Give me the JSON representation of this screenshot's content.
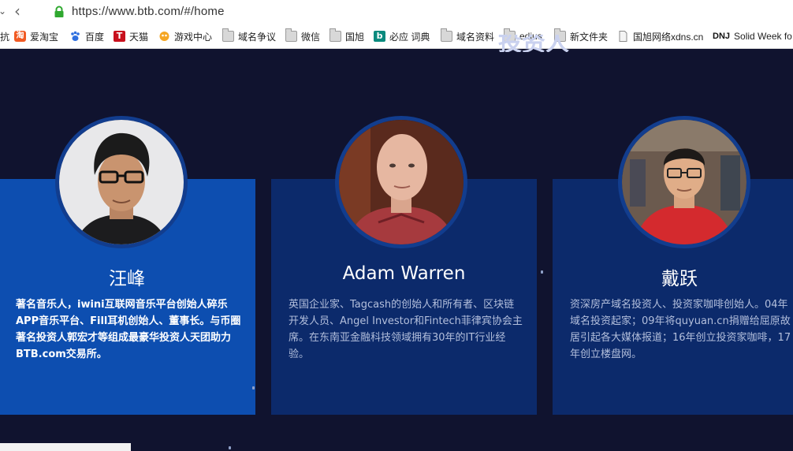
{
  "browser": {
    "url": "https://www.btb.com/#/home",
    "bookmarks": [
      {
        "label": "抗",
        "icon": "none"
      },
      {
        "label": "爱淘宝",
        "icon": "taobao-icon"
      },
      {
        "label": "百度",
        "icon": "baidu-paw-icon"
      },
      {
        "label": "天猫",
        "icon": "tmall-icon"
      },
      {
        "label": "游戏中心",
        "icon": "game-center-icon"
      },
      {
        "label": "域名争议",
        "icon": "folder-icon"
      },
      {
        "label": "微信",
        "icon": "folder-icon"
      },
      {
        "label": "国旭",
        "icon": "folder-icon"
      },
      {
        "label": "必应 词典",
        "icon": "bing-icon"
      },
      {
        "label": "域名资料",
        "icon": "folder-icon"
      },
      {
        "label": "edius",
        "icon": "folder-icon"
      },
      {
        "label": "新文件夹",
        "icon": "folder-icon"
      },
      {
        "label": "国旭网络xdns.cn",
        "icon": "page-icon"
      },
      {
        "label": "Solid Week fo",
        "icon": "dnj-icon"
      }
    ],
    "dnj_text": "DNJ"
  },
  "section": {
    "heading_partial": "投资人"
  },
  "investors": [
    {
      "name": "汪峰",
      "bio": "著名音乐人，iwini互联网音乐平台创始人碎乐APP音乐平台、Fill耳机创始人、董事长。与币圈著名投资人郭宏才等组成最豪华投资人天团助力BTB.com交易所。",
      "photo": "avatar-musician-photo"
    },
    {
      "name": "Adam Warren",
      "bio": "英国企业家、Tagcash的创始人和所有者、区块链开发人员、Angel Investor和Fintech菲律宾协会主席。在东南亚金融科技领域拥有30年的IT行业经验。",
      "photo": "avatar-bald-man-photo"
    },
    {
      "name": "戴跃",
      "bio": "资深房产域名投资人、投资家咖啡创始人。04年域名投资起家；09年将quyuan.cn捐赠给屈原故居引起各大媒体报道；16年创立投资家咖啡，17年创立楼盘网。",
      "photo": "avatar-man-glasses-photo"
    }
  ],
  "colors": {
    "page_bg": "#10132f",
    "card_active": "#0d4eb0",
    "card": "#0c2a6b",
    "avatar_ring": "#123d8e"
  }
}
